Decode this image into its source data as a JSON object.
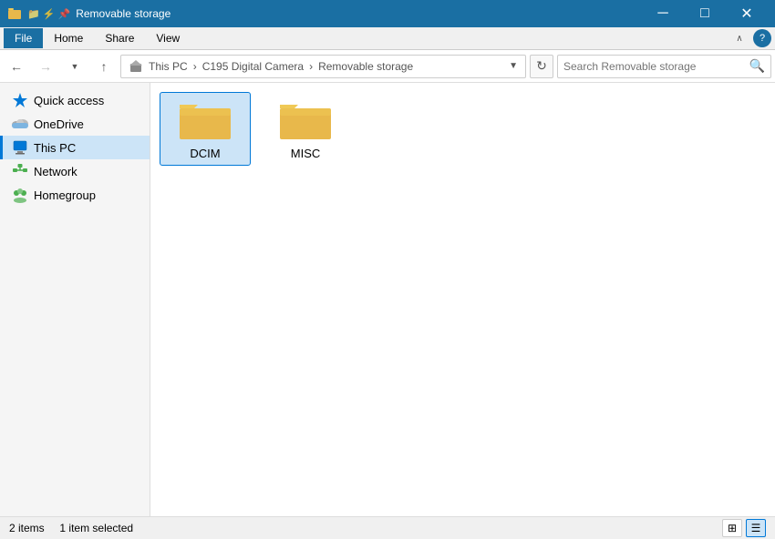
{
  "titlebar": {
    "title": "Removable storage",
    "minimize": "─",
    "maximize": "□",
    "close": "✕"
  },
  "ribbon": {
    "tabs": [
      "File",
      "Home",
      "Share",
      "View"
    ],
    "active_tab": "Home",
    "expand_icon": "∧",
    "help_label": "?"
  },
  "toolbar": {
    "back_label": "←",
    "forward_label": "→",
    "up_label": "↑",
    "breadcrumb": [
      {
        "label": "This PC",
        "sep": "›"
      },
      {
        "label": "C195 Digital Camera",
        "sep": "›"
      },
      {
        "label": "Removable storage",
        "sep": ""
      }
    ],
    "refresh_label": "↻",
    "search_placeholder": "Search Removable storage"
  },
  "sidebar": {
    "items": [
      {
        "id": "quick-access",
        "label": "Quick access",
        "icon": "star"
      },
      {
        "id": "onedrive",
        "label": "OneDrive",
        "icon": "cloud"
      },
      {
        "id": "this-pc",
        "label": "This PC",
        "icon": "computer",
        "active": true
      },
      {
        "id": "network",
        "label": "Network",
        "icon": "network"
      },
      {
        "id": "homegroup",
        "label": "Homegroup",
        "icon": "homegroup"
      }
    ]
  },
  "content": {
    "folders": [
      {
        "id": "dcim",
        "label": "DCIM",
        "selected": true
      },
      {
        "id": "misc",
        "label": "MISC",
        "selected": false
      }
    ]
  },
  "statusbar": {
    "count": "2 items",
    "selected": "1 item selected",
    "view_grid_label": "⊞",
    "view_list_label": "☰"
  },
  "colors": {
    "accent": "#0078d7",
    "titlebar_bg": "#1a6fa3",
    "folder_body": "#e8b84b",
    "folder_tab": "#f0c956",
    "selected_bg": "#cce4f7",
    "sidebar_active_bg": "#cce4f7"
  }
}
